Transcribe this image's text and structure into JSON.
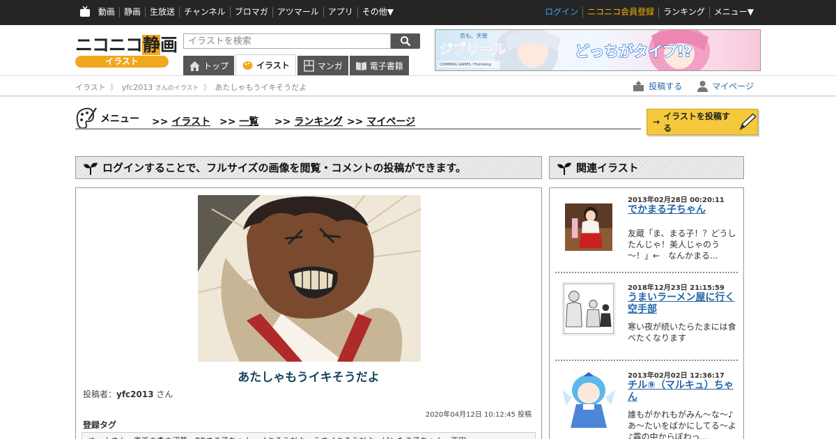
{
  "topbar": {
    "nav": [
      "動画",
      "静画",
      "生放送",
      "チャンネル",
      "ブロマガ",
      "アツマール",
      "アプリ",
      "その他▼"
    ],
    "login": "ログイン",
    "register": "ニコニコ会員登録",
    "ranking": "ランキング",
    "menu": "メニュー▼"
  },
  "logo": {
    "main_a": "ニコニコ",
    "main_b": "静",
    "main_c": "画",
    "sub": "イラスト"
  },
  "search": {
    "placeholder": "イラストを検索"
  },
  "tabs": [
    {
      "label": "トップ",
      "icon": "home-icon"
    },
    {
      "label": "イラスト",
      "icon": "illust-icon"
    },
    {
      "label": "マンガ",
      "icon": "manga-icon"
    },
    {
      "label": "電子書籍",
      "icon": "book-icon"
    }
  ],
  "banner": {
    "brand": "ジブリール",
    "catch": "どっちがタイプ!?",
    "tagline": "恋も、天使",
    "publisher": "COMMING GAMES / Frontwing"
  },
  "breadcrumb": {
    "root": "イラスト",
    "user": "yfc2013",
    "user_suffix": "さんのイラスト",
    "current": "あたしゃもうイキそうだよ"
  },
  "actions": {
    "post": "投稿する",
    "mypage": "マイページ"
  },
  "submenu": {
    "title": "メニュー",
    "items": [
      "イラスト",
      "一覧",
      "ランキング",
      "マイページ"
    ],
    "prefix": ">>",
    "post_button": "イラストを投稿する"
  },
  "notice": "ログインすることで、フルサイズの画像を閲覧・コメントの投稿ができます。",
  "related_heading": "関連イラスト",
  "artwork": {
    "title": "あたしゃもうイキそうだよ",
    "poster_label": "投稿者：",
    "poster": "yfc2013",
    "poster_suffix": "さん",
    "posted_at": "2020年04月12日 10:12:45 投稿",
    "tags_label": "登録タグ",
    "tags_text": "オーナさん　直画の森の沼草　BBさる子ちゃん　イキそうだよ　うさイキそうだよ　ピンたる子ちゃん　西田"
  },
  "related": [
    {
      "date": "2013年02月28日 00:20:11",
      "title": "でかまる子ちゃん",
      "desc": "友蔵「ま、まる子！？どうしたんじゃ！美人じゃのう～！」←　なんかまる..."
    },
    {
      "date": "2018年12月23日 21:15:59",
      "title": "うまいラーメン屋に行く空手部",
      "desc": "寒い夜が続いたらたまには食べたくなります"
    },
    {
      "date": "2013年02月02日 12:36:17",
      "title": "チル⑨（マルキュ）ちゃん",
      "desc": "誰もがかれもがみん～な～♪あ～たいをばかにしてる～よ♪霧の中からぼわっ..."
    }
  ],
  "colors": {
    "accent": "#f1a81e",
    "link": "#2565a8",
    "topbar": "#252525",
    "title": "#15455d"
  }
}
